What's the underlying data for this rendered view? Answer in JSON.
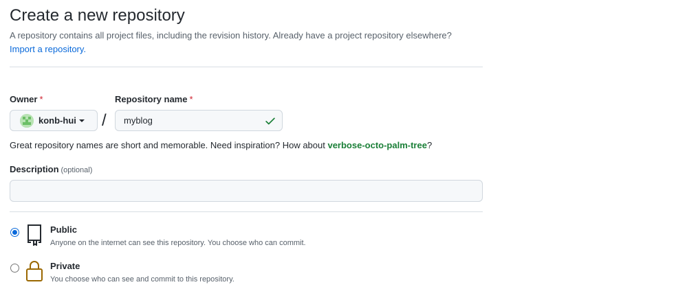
{
  "header": {
    "title": "Create a new repository",
    "subtitle": "A repository contains all project files, including the revision history. Already have a project repository elsewhere?",
    "import_link": "Import a repository."
  },
  "owner": {
    "label": "Owner",
    "required_mark": "*",
    "value": "konb-hui"
  },
  "separator": "/",
  "repo_name": {
    "label": "Repository name",
    "required_mark": "*",
    "value": "myblog",
    "status_icon": "check-icon"
  },
  "hint": {
    "text": "Great repository names are short and memorable. Need inspiration? How about ",
    "suggestion": "verbose-octo-palm-tree",
    "suffix": "?"
  },
  "description": {
    "label": "Description",
    "optional": "(optional)",
    "value": ""
  },
  "visibility": {
    "options": [
      {
        "title": "Public",
        "description": "Anyone on the internet can see this repository. You choose who can commit.",
        "icon": "repo-icon",
        "selected": true
      },
      {
        "title": "Private",
        "description": "You choose who can see and commit to this repository.",
        "icon": "lock-icon",
        "selected": false
      }
    ]
  },
  "colors": {
    "accent": "#0969da",
    "success": "#1a7f37",
    "required": "#cf222e",
    "lock_icon": "#9a6700"
  }
}
